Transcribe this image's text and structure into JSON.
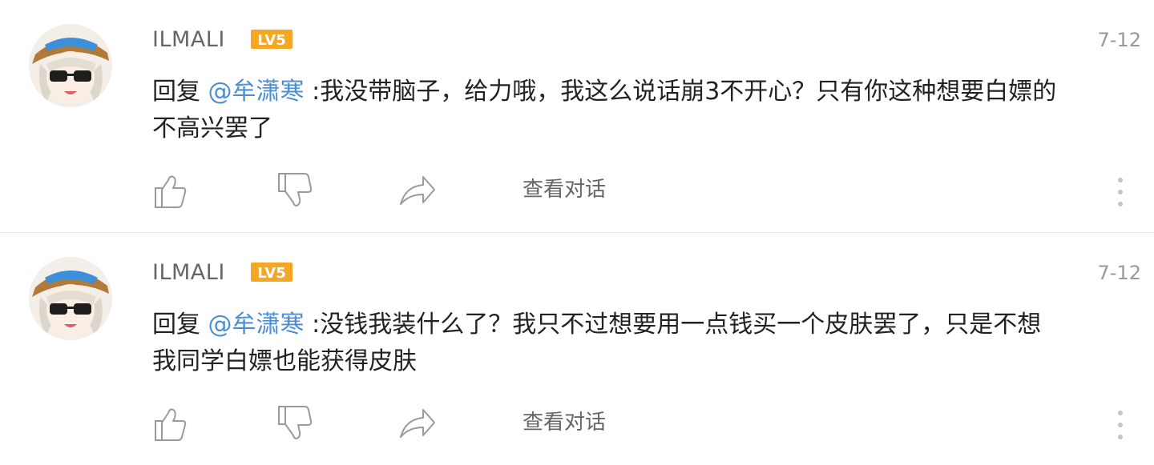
{
  "comments": [
    {
      "username": "ILMALI",
      "level": "LV5",
      "date": "7-12",
      "reply_prefix": "回复 ",
      "mention": "@牟潇寒",
      "text": " :我没带脑子，给力哦，我这么说话崩3不开心？只有你这种想要白嫖的不高兴罢了",
      "view_conversation": "查看对话",
      "icons": {
        "like": "thumbs-up-icon",
        "dislike": "thumbs-down-icon",
        "share": "share-arrow-icon",
        "more": "more-vertical-icon"
      }
    },
    {
      "username": "ILMALI",
      "level": "LV5",
      "date": "7-12",
      "reply_prefix": "回复 ",
      "mention": "@牟潇寒",
      "text": " :没钱我装什么了？我只不过想要用一点钱买一个皮肤罢了，只是不想我同学白嫖也能获得皮肤",
      "view_conversation": "查看对话",
      "icons": {
        "like": "thumbs-up-icon",
        "dislike": "thumbs-down-icon",
        "share": "share-arrow-icon",
        "more": "more-vertical-icon"
      }
    }
  ],
  "colors": {
    "mention": "#4a8fd4",
    "level_badge": "#f5a623",
    "username": "#666666",
    "text": "#222222",
    "meta": "#999999"
  }
}
